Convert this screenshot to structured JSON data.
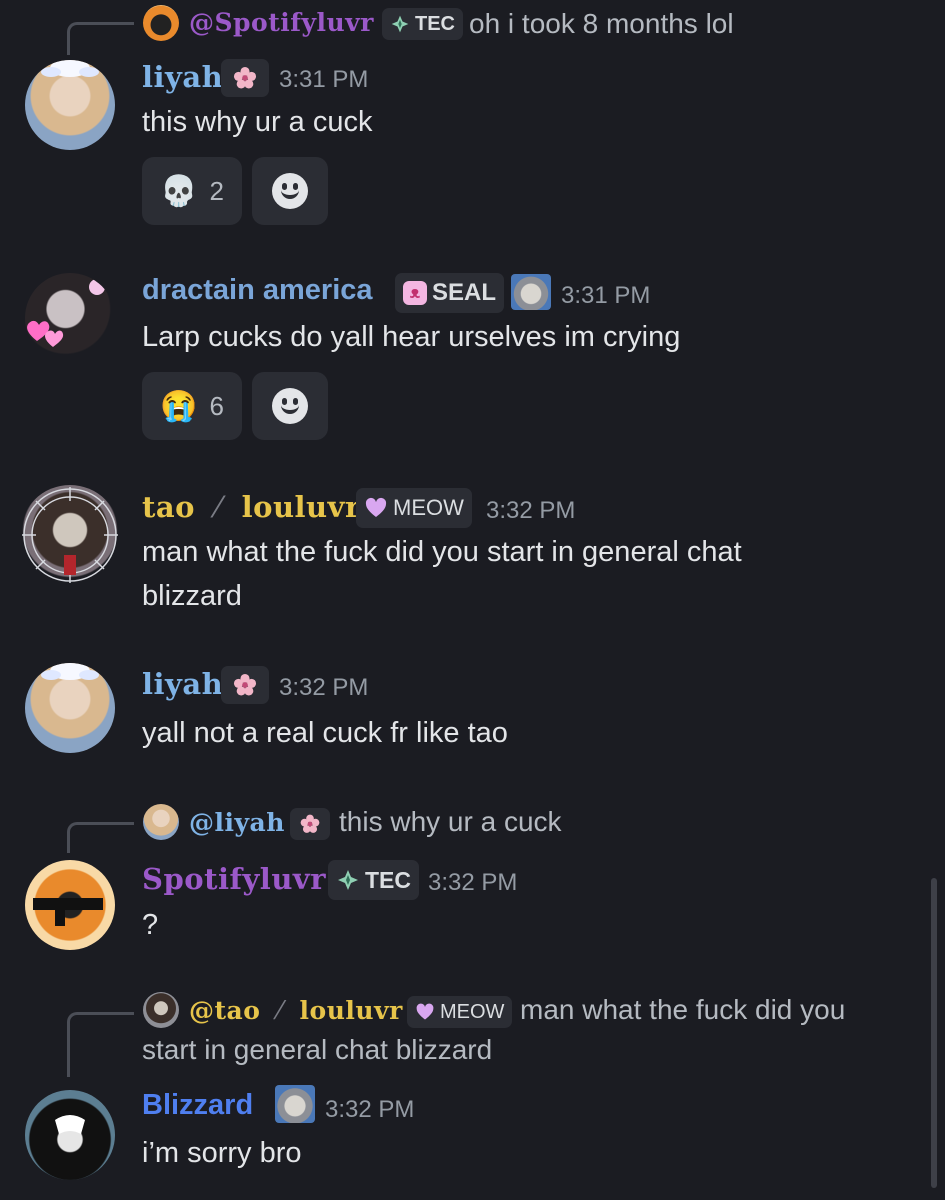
{
  "colors": {
    "background": "#1b1c22",
    "liyah": "#7fb3e6",
    "dractain": "#7aa5d8",
    "tao": "#e7c44a",
    "spotifyluvr": "#9b59c9",
    "blizzard": "#4f7ff0",
    "time": "#949ba4"
  },
  "messages": [
    {
      "reply": {
        "mention": "@Spotifyluvr",
        "tag": "TEC",
        "text": "oh i took 8 months lol"
      }
    },
    {
      "author": "liyah",
      "tag_icon": "sakura-icon",
      "time": "3:31 PM",
      "lines": [
        "this why ur a cuck"
      ],
      "reaction": {
        "emoji": "💀",
        "count": "2",
        "icon": "skull-icon"
      }
    },
    {
      "author": "dractain america",
      "tag": "SEAL",
      "tag_icon": "bunny-icon",
      "time": "3:31 PM",
      "lines": [
        "Larp cucks do yall hear urselves im crying"
      ],
      "reaction": {
        "emoji": "😭",
        "count": "6",
        "icon": "crying-face-icon"
      }
    },
    {
      "author_parts": [
        "tao",
        "⁄",
        "louluvr"
      ],
      "tag": "MEOW",
      "time": "3:32 PM",
      "lines": [
        "man what the fuck did you start in general chat",
        "blizzard"
      ]
    },
    {
      "author": "liyah",
      "time": "3:32 PM",
      "lines": [
        "yall not a real cuck fr like tao"
      ]
    },
    {
      "reply": {
        "mention": "@liyah",
        "text": "this why ur a cuck"
      },
      "author": "Spotifyluvr",
      "tag": "TEC",
      "time": "3:32 PM",
      "lines": [
        "?"
      ]
    },
    {
      "reply": {
        "mention_parts": [
          "@tao",
          "⁄",
          "louluvr"
        ],
        "tag": "MEOW",
        "text_lines": [
          "man what the fuck did you",
          "start in general chat blizzard"
        ]
      },
      "author": "Blizzard",
      "time": "3:32 PM",
      "lines": [
        "i’m sorry bro"
      ]
    }
  ]
}
